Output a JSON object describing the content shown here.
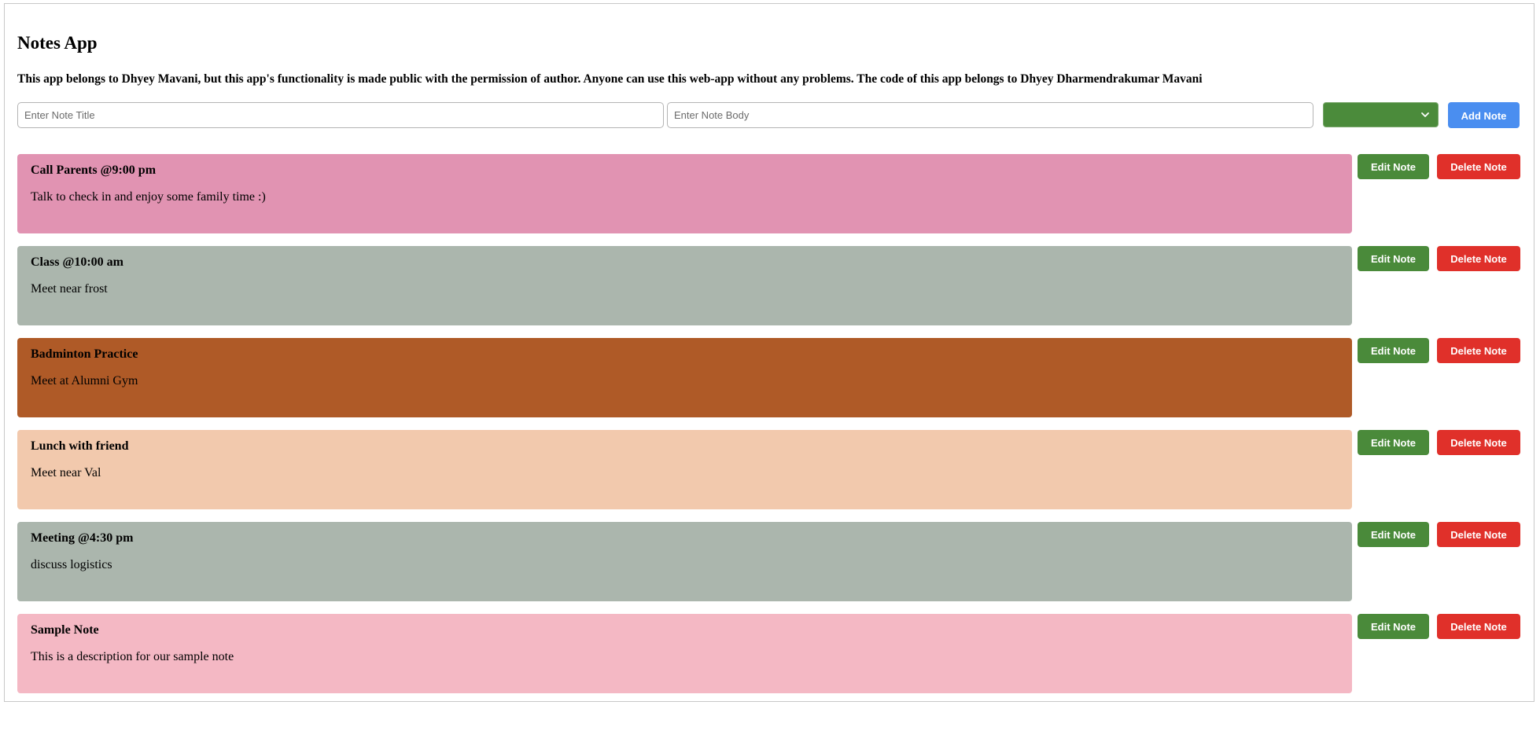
{
  "app": {
    "title": "Notes App",
    "description": "This app belongs to Dhyey Mavani, but this app's functionality is made public with the permission of author. Anyone can use this web-app without any problems. The code of this app belongs to Dhyey Dharmendrakumar Mavani"
  },
  "form": {
    "title_placeholder": "Enter Note Title",
    "title_value": "",
    "body_placeholder": "Enter Note Body",
    "body_value": "",
    "color_select": {
      "selected_label": "",
      "selected_color": "#4b8b3b",
      "icon": "chevron-down-icon"
    },
    "add_button_label": "Add Note",
    "add_button_color": "#4a8ef0"
  },
  "note_actions": {
    "edit_label": "Edit Note",
    "edit_color": "#4a8a3a",
    "delete_label": "Delete Note",
    "delete_color": "#e0302a"
  },
  "notes": [
    {
      "title": "Call Parents @9:00 pm",
      "body": "Talk to check in and enjoy some family time :)",
      "color": "#e193b2"
    },
    {
      "title": "Class @10:00 am",
      "body": "Meet near frost",
      "color": "#abb6ad"
    },
    {
      "title": "Badminton Practice",
      "body": "Meet at Alumni Gym",
      "color": "#af5a27"
    },
    {
      "title": "Lunch with friend",
      "body": "Meet near Val",
      "color": "#f2c9ad"
    },
    {
      "title": "Meeting @4:30 pm",
      "body": "discuss logistics",
      "color": "#abb6ad"
    },
    {
      "title": "Sample Note",
      "body": "This is a description for our sample note",
      "color": "#f4b8c4"
    }
  ]
}
